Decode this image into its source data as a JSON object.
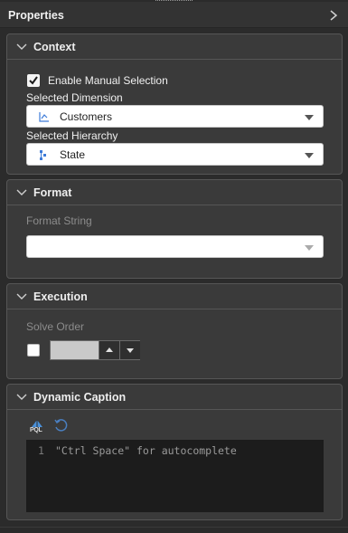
{
  "header": {
    "title": "Properties",
    "collapse_icon": "chevron-right-icon"
  },
  "context": {
    "title": "Context",
    "enable_manual_selection": {
      "label": "Enable Manual Selection",
      "checked": true
    },
    "selected_dimension": {
      "label": "Selected Dimension",
      "value": "Customers",
      "icon": "dimension-icon"
    },
    "selected_hierarchy": {
      "label": "Selected Hierarchy",
      "value": "State",
      "icon": "hierarchy-icon"
    }
  },
  "format": {
    "title": "Format",
    "format_string": {
      "label": "Format String",
      "value": ""
    }
  },
  "execution": {
    "title": "Execution",
    "solve_order": {
      "label": "Solve Order",
      "checked": false,
      "value": ""
    }
  },
  "dynamic_caption": {
    "title": "Dynamic Caption",
    "toolbar": {
      "pql_label": "PQL",
      "pql_icon": "pql-icon",
      "refresh_icon": "refresh-icon"
    },
    "editor": {
      "line_number": "1",
      "placeholder": "\"Ctrl Space\" for autocomplete"
    }
  },
  "colors": {
    "panel_bg": "#3a3a3a",
    "page_bg": "#2b2b2b",
    "editor_bg": "#1c1c1c",
    "muted_text": "#8c8c8c"
  }
}
